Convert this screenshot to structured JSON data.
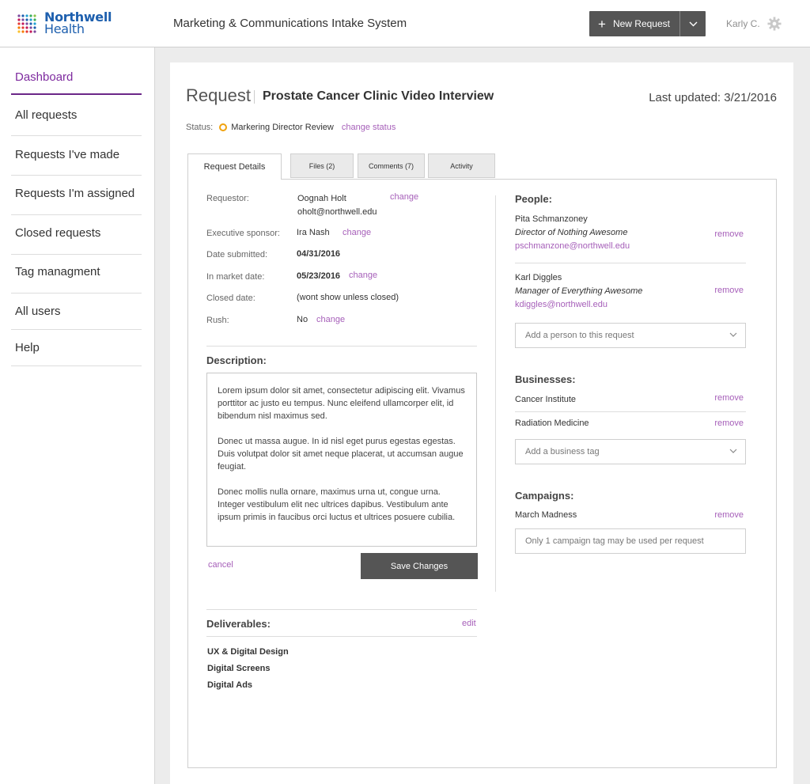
{
  "header": {
    "logo_line1": "Northwell",
    "logo_line2": "Health",
    "app_title": "Marketing & Communications Intake System",
    "new_request_label": "New Request",
    "user_name": "Karly C."
  },
  "sidebar": {
    "items": [
      {
        "label": "Dashboard"
      },
      {
        "label": "All requests"
      },
      {
        "label": "Requests I've made"
      },
      {
        "label": "Requests I'm assigned"
      },
      {
        "label": "Closed requests"
      },
      {
        "label": "Tag managment"
      },
      {
        "label": "All users"
      },
      {
        "label": "Help"
      }
    ]
  },
  "request": {
    "label": "Request",
    "title": "Prostate Cancer Clinic Video Interview",
    "last_updated": "Last updated: 3/21/2016",
    "status_label": "Status:",
    "status_value": "Markering Director Review",
    "status_color": "#f0a20e",
    "change_status": "change status"
  },
  "tabs": [
    {
      "label": "Request Details"
    },
    {
      "label": "Files (2)"
    },
    {
      "label": "Comments (7)"
    },
    {
      "label": "Activity"
    }
  ],
  "details": {
    "requestor_label": "Requestor:",
    "requestor_name": "Oognah Holt",
    "requestor_email": "oholt@northwell.edu",
    "sponsor_label": "Executive sponsor:",
    "sponsor_value": "Ira Nash",
    "submitted_label": "Date submitted:",
    "submitted_value": "04/31/2016",
    "market_label": "In market date:",
    "market_value": "05/23/2016",
    "closed_label": "Closed date:",
    "closed_value": "(wont show unless closed)",
    "rush_label": "Rush:",
    "rush_value": "No",
    "change_label": "change"
  },
  "description": {
    "heading": "Description:",
    "paragraphs": [
      "Lorem ipsum dolor sit amet, consectetur adipiscing elit. Vivamus porttitor ac justo eu tempus. Nunc eleifend ullamcorper elit, id bibendum nisl maximus sed.",
      "Donec ut massa augue. In id nisl eget purus egestas egestas. Duis volutpat dolor sit amet neque placerat, ut accumsan augue feugiat.",
      "Donec mollis nulla ornare, maximus urna ut, congue urna. Integer vestibulum elit nec ultrices dapibus. Vestibulum ante ipsum primis in faucibus orci luctus et ultrices posuere cubilia."
    ],
    "cancel_label": "cancel",
    "save_label": "Save Changes"
  },
  "deliverables": {
    "heading": "Deliverables:",
    "edit_label": "edit",
    "items": [
      "UX & Digital Design",
      "Digital Screens",
      "Digital Ads"
    ]
  },
  "people": {
    "heading": "People:",
    "remove_label": "remove",
    "list": [
      {
        "name": "Pita Schmanzoney",
        "title": "Director of Nothing Awesome",
        "email": "pschmanzone@northwell.edu"
      },
      {
        "name": "Karl Diggles",
        "title": "Manager of Everything Awesome",
        "email": "kdiggles@northwell.edu"
      }
    ],
    "add_placeholder": "Add  a person to this request"
  },
  "businesses": {
    "heading": "Businesses:",
    "list": [
      "Cancer Institute",
      "Radiation Medicine"
    ],
    "add_placeholder": "Add  a business tag"
  },
  "campaigns": {
    "heading": "Campaigns:",
    "list": [
      "March Madness"
    ],
    "note": "Only 1 campaign tag may be used per request"
  }
}
